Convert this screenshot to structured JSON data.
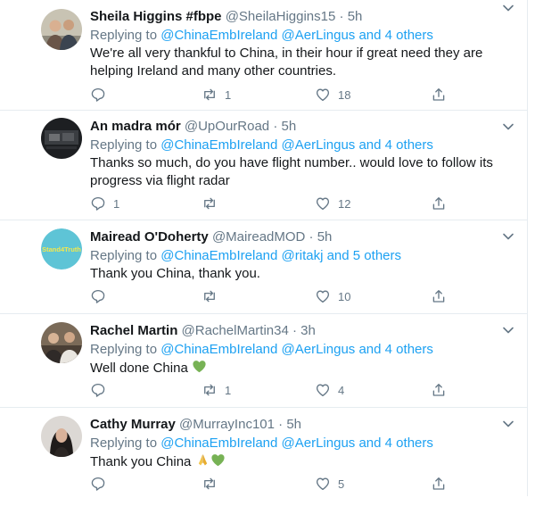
{
  "reply_prefix": "Replying to",
  "reply_joiner": "and",
  "tweets": [
    {
      "name": "Sheila Higgins #fbpe",
      "handle": "@SheilaHiggins15",
      "time": "5h",
      "mentions": "@ChinaEmbIreland @AerLingus",
      "others": "4 others",
      "text": "We're all very thankful to China, in their hour if great need they are helping Ireland and many other countries.",
      "replies": "",
      "retweets": "1",
      "likes": "18"
    },
    {
      "name": "An madra mór",
      "handle": "@UpOurRoad",
      "time": "5h",
      "mentions": "@ChinaEmbIreland @AerLingus",
      "others": "4 others",
      "text": "Thanks so much, do you have flight number.. would love to follow its progress via flight radar",
      "replies": "1",
      "retweets": "",
      "likes": "12"
    },
    {
      "name": "Mairead O'Doherty",
      "handle": "@MaireadMOD",
      "time": "5h",
      "mentions": "@ChinaEmbIreland @ritakj",
      "others": "5 others",
      "avatar_text": "Stand4Truth",
      "text": "Thank you China, thank you.",
      "replies": "",
      "retweets": "",
      "likes": "10"
    },
    {
      "name": "Rachel Martin",
      "handle": "@RachelMartin34",
      "time": "3h",
      "mentions": "@ChinaEmbIreland @AerLingus",
      "others": "4 others",
      "text": "Well done China",
      "replies": "",
      "retweets": "1",
      "likes": "4"
    },
    {
      "name": "Cathy Murray",
      "handle": "@MurrayInc101",
      "time": "5h",
      "mentions": "@ChinaEmbIreland @AerLingus",
      "others": "4 others",
      "text": "Thank you China",
      "replies": "",
      "retweets": "",
      "likes": "5"
    }
  ],
  "colors": {
    "link": "#1da1f2",
    "muted": "#657786",
    "text": "#14171a",
    "divider": "#e6ecf0",
    "green_heart": "#77b255",
    "avatar_teal": "#5ec4d6"
  },
  "icons": [
    "reply-icon",
    "retweet-icon",
    "like-icon",
    "share-icon",
    "chevron-down-icon",
    "green-heart-icon",
    "folded-hands-icon"
  ]
}
